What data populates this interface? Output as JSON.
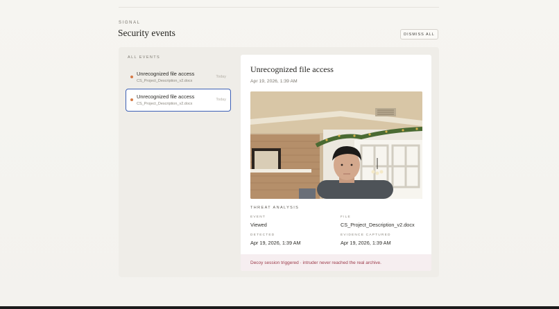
{
  "header": {
    "eyebrow": "SIGNAL",
    "title": "Security events",
    "dismiss_label": "DISMISS ALL"
  },
  "list": {
    "heading": "ALL EVENTS",
    "items": [
      {
        "title": "Unrecognized file access",
        "file": "CS_Project_Description_v2.docx",
        "time": "Today",
        "selected": false
      },
      {
        "title": "Unrecognized file access",
        "file": "CS_Project_Description_v2.docx",
        "time": "Today",
        "selected": true
      }
    ]
  },
  "detail": {
    "title": "Unrecognized file access",
    "date": "Apr 19, 2026, 1:39 AM",
    "threat_heading": "THREAT ANALYSIS",
    "fields": {
      "event_label": "EVENT",
      "event_value": "Viewed",
      "file_label": "FILE",
      "file_value": "CS_Project_Description_v2.docx",
      "detected_label": "DETECTED",
      "detected_value": "Apr 19, 2026, 1:39 AM",
      "evidence_label": "EVIDENCE CAPTURED",
      "evidence_value": "Apr 19, 2026, 1:39 AM"
    },
    "decoy_note": "Decoy session triggered · intruder never reached the real archive."
  },
  "colors": {
    "accent": "#3b5fb5",
    "status_dot": "#d57a46",
    "decoy_text": "#9c3a4a",
    "decoy_bg": "#f6eef0"
  }
}
